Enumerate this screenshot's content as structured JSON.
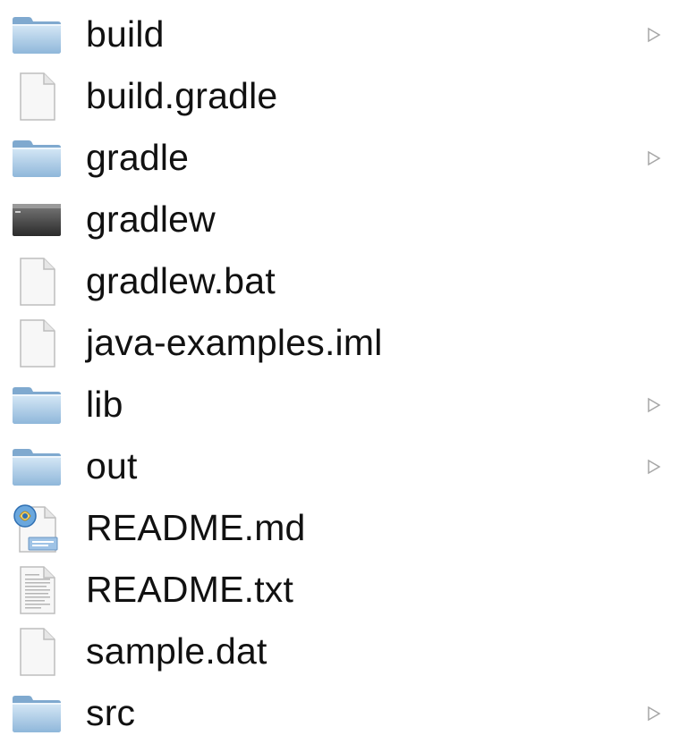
{
  "files": [
    {
      "name": "build",
      "kind": "folder",
      "icon": "folder-icon",
      "expandable": true
    },
    {
      "name": "build.gradle",
      "kind": "document",
      "icon": "document-icon",
      "expandable": false
    },
    {
      "name": "gradle",
      "kind": "folder",
      "icon": "folder-icon",
      "expandable": true
    },
    {
      "name": "gradlew",
      "kind": "executable",
      "icon": "terminal-executable-icon",
      "expandable": false
    },
    {
      "name": "gradlew.bat",
      "kind": "document",
      "icon": "document-icon",
      "expandable": false
    },
    {
      "name": "java-examples.iml",
      "kind": "document",
      "icon": "document-icon",
      "expandable": false
    },
    {
      "name": "lib",
      "kind": "folder",
      "icon": "folder-icon",
      "expandable": true
    },
    {
      "name": "out",
      "kind": "folder",
      "icon": "folder-icon",
      "expandable": true
    },
    {
      "name": "README.md",
      "kind": "markdown",
      "icon": "markdown-text-icon",
      "expandable": false
    },
    {
      "name": "README.txt",
      "kind": "text",
      "icon": "text-document-icon",
      "expandable": false
    },
    {
      "name": "sample.dat",
      "kind": "document",
      "icon": "document-icon",
      "expandable": false
    },
    {
      "name": "src",
      "kind": "folder",
      "icon": "folder-icon",
      "expandable": true
    }
  ],
  "colors": {
    "folder_light": "#cfe3f3",
    "folder_dark": "#7fa9cf",
    "disclosure": "#a6a6a6",
    "text": "#111111"
  }
}
